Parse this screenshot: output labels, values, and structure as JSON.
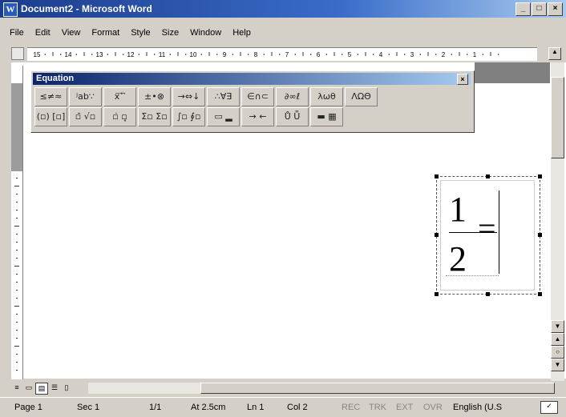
{
  "window": {
    "title": "Document2 - Microsoft Word",
    "app_icon": "W",
    "buttons": {
      "minimize": "_",
      "maximize": "□",
      "close": "×"
    }
  },
  "menu": [
    "File",
    "Edit",
    "View",
    "Format",
    "Style",
    "Size",
    "Window",
    "Help"
  ],
  "ruler": {
    "labels": [
      "15",
      "14",
      "13",
      "12",
      "11",
      "10",
      "9",
      "8",
      "7",
      "6",
      "5",
      "4",
      "3",
      "2",
      "1"
    ]
  },
  "equation_toolbar": {
    "title": "Equation",
    "close": "×",
    "row1": [
      "≤≠≈",
      "ʲab∵",
      "ẍ ⃗ ⃡",
      "±•⊗",
      "→⇔↓",
      "∴∀∃",
      "∈∩⊂",
      "∂∞ℓ",
      "λωθ",
      "ΛΩΘ"
    ],
    "row2": [
      "(▫) [▫]",
      "▫̄ √▫",
      "▫̇ ▫̥",
      "Σ▫ Σ▫",
      "∫▫ ∮▫",
      "▭ ▂",
      "→ ←",
      "Ů Ṻ",
      "▬ ▦"
    ]
  },
  "equation": {
    "numerator": "1",
    "denominator": "2",
    "sign": "="
  },
  "view_buttons": [
    "≡",
    "▭",
    "▤",
    "☰",
    "▯"
  ],
  "status": {
    "page": "Page 1",
    "sec": "Sec 1",
    "pages": "1/1",
    "at": "At 2.5cm",
    "ln": "Ln 1",
    "col": "Col 2",
    "rec": "REC",
    "trk": "TRK",
    "ext": "EXT",
    "ovr": "OVR",
    "language": "English (U.S"
  }
}
